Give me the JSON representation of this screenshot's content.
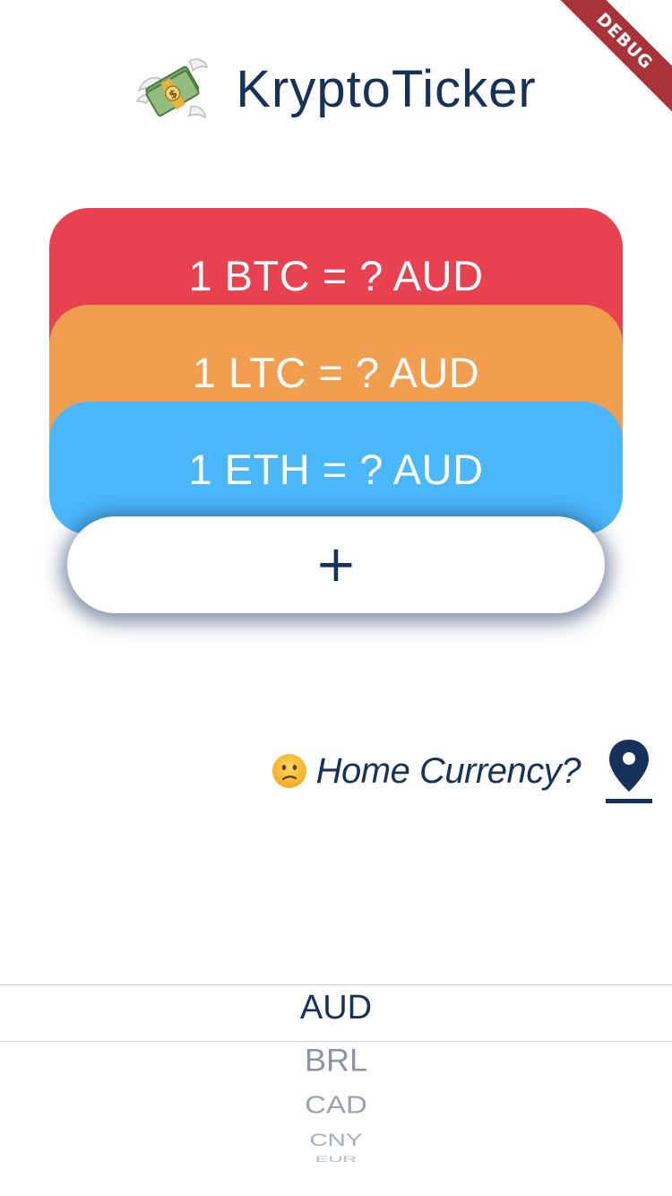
{
  "app": {
    "title": "KryptoTicker",
    "logo_icon": "money-with-wings-icon",
    "debug_banner": "DEBUG"
  },
  "colors": {
    "primary_text": "#17325a",
    "btc_card": "#e84150",
    "ltc_card": "#f19e4f",
    "eth_card": "#4ab7fa",
    "debug_banner": "#a8343a"
  },
  "tickers": [
    {
      "label": "1 BTC = ? AUD"
    },
    {
      "label": "1 LTC = ? AUD"
    },
    {
      "label": "1 ETH = ? AUD"
    }
  ],
  "add_button": {
    "label": "+",
    "icon": "plus-icon"
  },
  "home_currency": {
    "emoji_icon": "confused-face-icon",
    "label": "Home Currency?",
    "location_icon": "location-pin-icon"
  },
  "currency_picker": {
    "selected": "AUD",
    "options": [
      "BRL",
      "CAD",
      "CNY",
      "EUR"
    ]
  }
}
